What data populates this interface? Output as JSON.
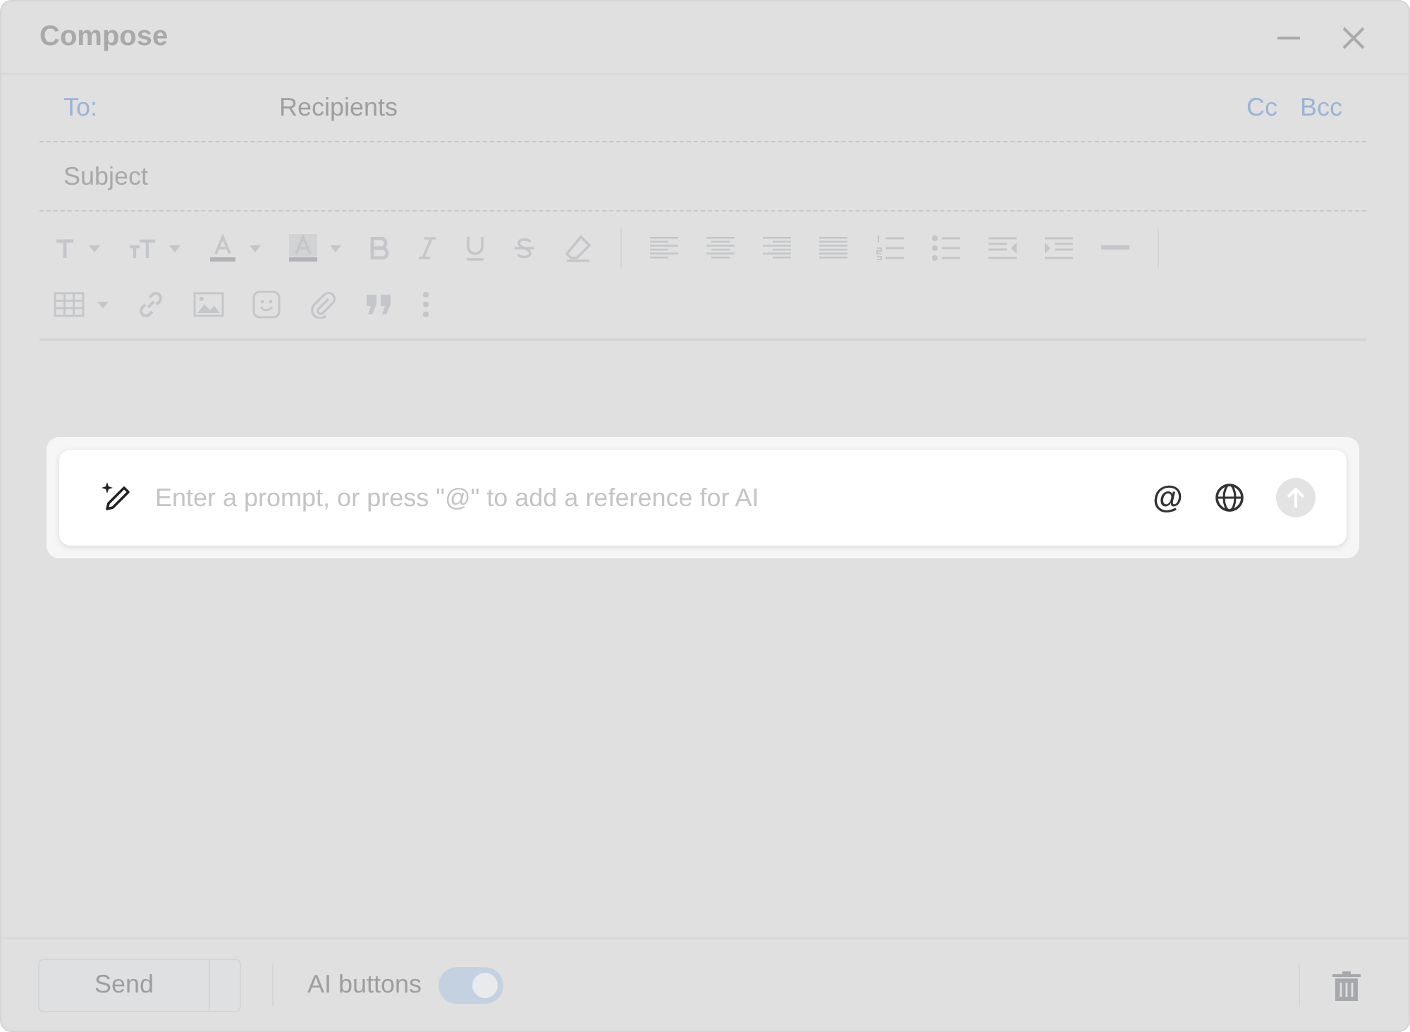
{
  "window": {
    "title": "Compose"
  },
  "to": {
    "label": "To:",
    "placeholder": "Recipients"
  },
  "cc": "Cc",
  "bcc": "Bcc",
  "subject": {
    "placeholder": "Subject"
  },
  "ai_prompt": {
    "placeholder": "Enter a prompt, or press \"@\" to add a reference for AI",
    "mention": "@"
  },
  "footer": {
    "send": "Send",
    "ai_buttons": {
      "label": "AI buttons",
      "on": true
    }
  }
}
